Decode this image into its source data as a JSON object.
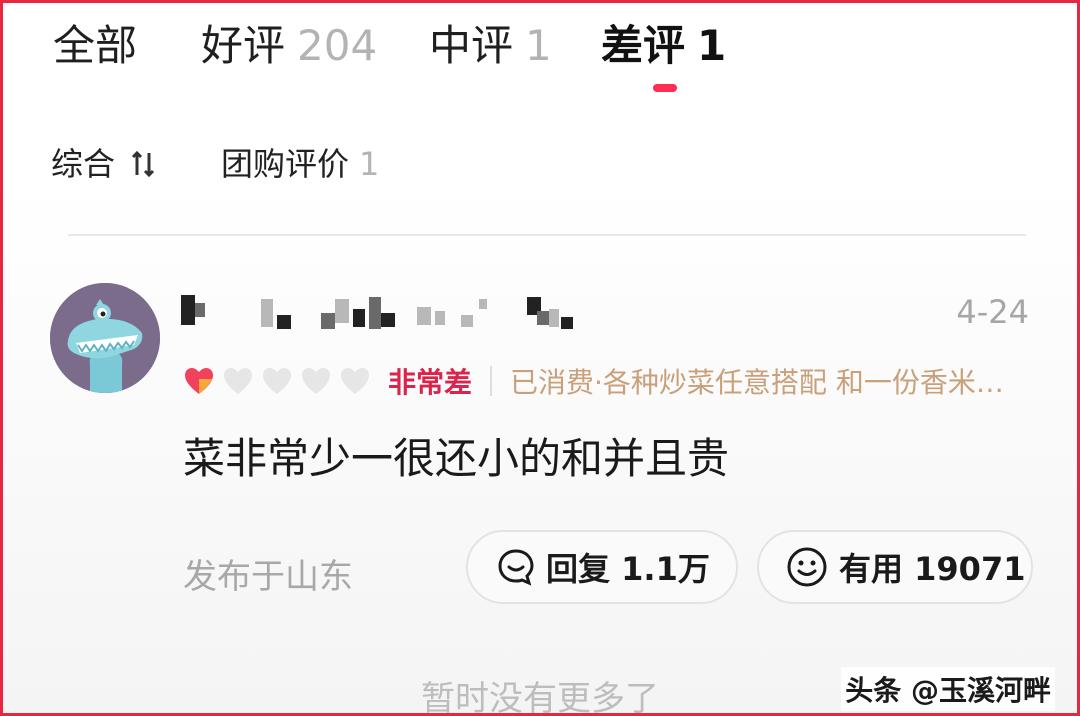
{
  "tabs": [
    {
      "label": "全部",
      "count": ""
    },
    {
      "label": "好评",
      "count": "204"
    },
    {
      "label": "中评",
      "count": "1"
    },
    {
      "label": "差评",
      "count": "1"
    }
  ],
  "active_tab": "差评",
  "filters": [
    {
      "label": "综合",
      "icon": "sort-icon"
    },
    {
      "label": "团购评价",
      "count": "1"
    }
  ],
  "review": {
    "date": "4-24",
    "hearts_filled": 1,
    "hearts_total": 5,
    "rating_label": "非常差",
    "consumed": "已消费·各种炒菜任意搭配 和一份香米…",
    "text": "菜非常少一很还小的和并且贵",
    "location": "发布于山东",
    "reply_label": "回复 1.1万",
    "useful_label": "有用 19071"
  },
  "footer": "暂时没有更多了",
  "watermark": "头条 @玉溪河畔",
  "colors": {
    "accent": "#ff2d55",
    "rating": "#d9254d",
    "consumed": "#c9a07a",
    "border": "#e8263f"
  }
}
